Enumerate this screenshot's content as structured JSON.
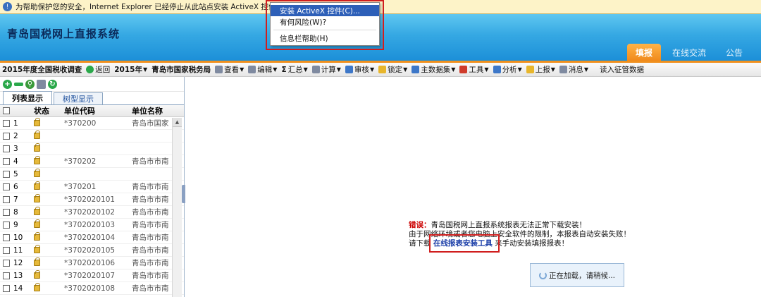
{
  "infobar": {
    "text": "为帮助保护您的安全，Internet Explorer 已经停止从此站点安装 ActiveX 控件...单击此处查看选项..."
  },
  "context_menu": {
    "items": [
      "安装 ActiveX 控件(C)...",
      "有何风险(W)?",
      "信息栏帮助(H)"
    ]
  },
  "header": {
    "title": "青岛国税网上直报系统",
    "tabs": [
      "填报",
      "在线交流",
      "公告"
    ]
  },
  "toolbar": {
    "items": [
      "2015年度全国税收调查",
      "返回",
      "2015年",
      "青岛市国家税务局",
      "查看",
      "编辑",
      "汇总",
      "计算",
      "审核",
      "锁定",
      "主数据集",
      "工具",
      "分析",
      "上报",
      "消息",
      "读入征管数据"
    ]
  },
  "left": {
    "tabs": [
      "列表显示",
      "树型显示"
    ],
    "columns": [
      "状态",
      "单位代码",
      "单位名称"
    ],
    "rows": [
      {
        "n": "1",
        "code": "*370200",
        "name": "青岛市国家"
      },
      {
        "n": "2",
        "code": "",
        "name": ""
      },
      {
        "n": "3",
        "code": "",
        "name": ""
      },
      {
        "n": "4",
        "code": "*370202",
        "name": "青岛市市南"
      },
      {
        "n": "5",
        "code": "",
        "name": ""
      },
      {
        "n": "6",
        "code": "*370201",
        "name": "青岛市市南"
      },
      {
        "n": "7",
        "code": "*3702020101",
        "name": "青岛市市南"
      },
      {
        "n": "8",
        "code": "*3702020102",
        "name": "青岛市市南"
      },
      {
        "n": "9",
        "code": "*3702020103",
        "name": "青岛市市南"
      },
      {
        "n": "10",
        "code": "*3702020104",
        "name": "青岛市市南"
      },
      {
        "n": "11",
        "code": "*3702020105",
        "name": "青岛市市南"
      },
      {
        "n": "12",
        "code": "*3702020106",
        "name": "青岛市市南"
      },
      {
        "n": "13",
        "code": "*3702020107",
        "name": "青岛市市南"
      },
      {
        "n": "14",
        "code": "*3702020108",
        "name": "青岛市市南"
      }
    ]
  },
  "error": {
    "label": "错误：",
    "line1": "青岛国税网上直报系统报表无法正常下载安装！",
    "line2": "由于网络环境或者您电脑上安全软件的限制，本报表自动安装失败！",
    "line3_pre": "请下载",
    "link": "在线报表安装工具",
    "line3_post": "来手动安装填报报表！"
  },
  "loading": {
    "text": "正在加载，请稍候..."
  }
}
